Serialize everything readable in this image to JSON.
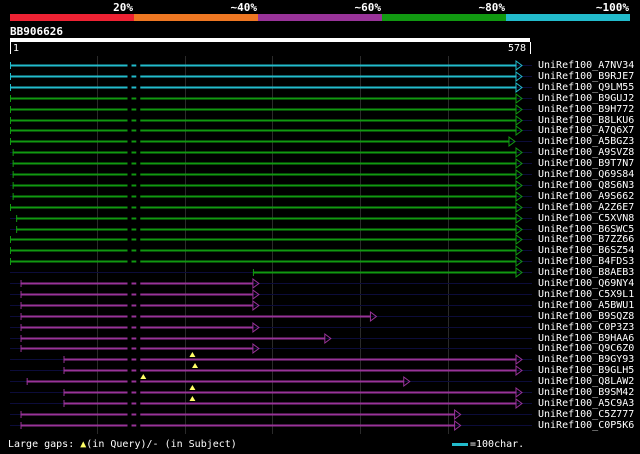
{
  "header": {
    "percent_labels": [
      "20%",
      "~40%",
      "~60%",
      "~80%",
      "~100%"
    ],
    "bar_colors": [
      "#ee2233",
      "#ee7722",
      "#993399",
      "#119911",
      "#22bbcc"
    ]
  },
  "query": {
    "name": "BB906626",
    "start": "1",
    "end": "578",
    "length": 578
  },
  "hits": [
    {
      "name": "UniRef100_A7NV34",
      "color": "#22bbcc",
      "start": 1,
      "end": 578,
      "gaps_query": []
    },
    {
      "name": "UniRef100_B9RJE7",
      "color": "#22bbcc",
      "start": 1,
      "end": 578,
      "gaps_query": []
    },
    {
      "name": "UniRef100_Q9LM55",
      "color": "#22bbcc",
      "start": 1,
      "end": 578,
      "gaps_query": []
    },
    {
      "name": "UniRef100_B9GUJ2",
      "color": "#119911",
      "start": 1,
      "end": 578,
      "gaps_query": []
    },
    {
      "name": "UniRef100_B9H772",
      "color": "#119911",
      "start": 1,
      "end": 578,
      "gaps_query": []
    },
    {
      "name": "UniRef100_B8LKU6",
      "color": "#119911",
      "start": 1,
      "end": 578,
      "gaps_query": []
    },
    {
      "name": "UniRef100_A7Q6X7",
      "color": "#119911",
      "start": 1,
      "end": 578,
      "gaps_query": []
    },
    {
      "name": "UniRef100_A5BGZ3",
      "color": "#119911",
      "start": 1,
      "end": 570,
      "gaps_query": []
    },
    {
      "name": "UniRef100_A9SVZ8",
      "color": "#119911",
      "start": 4,
      "end": 578,
      "gaps_query": []
    },
    {
      "name": "UniRef100_B9T7N7",
      "color": "#119911",
      "start": 4,
      "end": 578,
      "gaps_query": []
    },
    {
      "name": "UniRef100_Q69S84",
      "color": "#119911",
      "start": 4,
      "end": 578,
      "gaps_query": []
    },
    {
      "name": "UniRef100_Q8S6N3",
      "color": "#119911",
      "start": 4,
      "end": 578,
      "gaps_query": []
    },
    {
      "name": "UniRef100_A9S662",
      "color": "#119911",
      "start": 4,
      "end": 578,
      "gaps_query": []
    },
    {
      "name": "UniRef100_A2Z6E7",
      "color": "#119911",
      "start": 1,
      "end": 578,
      "gaps_query": []
    },
    {
      "name": "UniRef100_C5XVN8",
      "color": "#119911",
      "start": 8,
      "end": 578,
      "gaps_query": []
    },
    {
      "name": "UniRef100_B6SWC5",
      "color": "#119911",
      "start": 8,
      "end": 578,
      "gaps_query": []
    },
    {
      "name": "UniRef100_B7ZZ66",
      "color": "#119911",
      "start": 1,
      "end": 578,
      "gaps_query": []
    },
    {
      "name": "UniRef100_B6SZ54",
      "color": "#119911",
      "start": 1,
      "end": 578,
      "gaps_query": []
    },
    {
      "name": "UniRef100_B4FDS3",
      "color": "#119911",
      "start": 1,
      "end": 578,
      "gaps_query": []
    },
    {
      "name": "UniRef100_B8AEB3",
      "color": "#119911",
      "start": 278,
      "end": 578,
      "gaps_query": []
    },
    {
      "name": "UniRef100_Q69NY4",
      "color": "#993399",
      "start": 13,
      "end": 278,
      "gaps_query": []
    },
    {
      "name": "UniRef100_C5X9L1",
      "color": "#993399",
      "start": 13,
      "end": 278,
      "gaps_query": []
    },
    {
      "name": "UniRef100_A5BWU1",
      "color": "#993399",
      "start": 13,
      "end": 278,
      "gaps_query": []
    },
    {
      "name": "UniRef100_B9SQZ8",
      "color": "#993399",
      "start": 13,
      "end": 412,
      "gaps_query": []
    },
    {
      "name": "UniRef100_C0P3Z3",
      "color": "#993399",
      "start": 13,
      "end": 278,
      "gaps_query": []
    },
    {
      "name": "UniRef100_B9HAA6",
      "color": "#993399",
      "start": 13,
      "end": 360,
      "gaps_query": []
    },
    {
      "name": "UniRef100_Q9C6Z0",
      "color": "#993399",
      "start": 13,
      "end": 278,
      "gaps_query": []
    },
    {
      "name": "UniRef100_B9GY93",
      "color": "#993399",
      "start": 62,
      "end": 578,
      "gaps_query": [
        209
      ]
    },
    {
      "name": "UniRef100_B9GLH5",
      "color": "#993399",
      "start": 62,
      "end": 578,
      "gaps_query": [
        212
      ]
    },
    {
      "name": "UniRef100_Q8LAW2",
      "color": "#993399",
      "start": 20,
      "end": 450,
      "gaps_query": [
        153
      ]
    },
    {
      "name": "UniRef100_B9SM42",
      "color": "#993399",
      "start": 62,
      "end": 578,
      "gaps_query": [
        209
      ]
    },
    {
      "name": "UniRef100_A5C9A3",
      "color": "#993399",
      "start": 62,
      "end": 578,
      "gaps_query": [
        209
      ]
    },
    {
      "name": "UniRef100_C5Z777",
      "color": "#993399",
      "start": 13,
      "end": 508,
      "gaps_query": []
    },
    {
      "name": "UniRef100_C0P5K6",
      "color": "#993399",
      "start": 13,
      "end": 508,
      "gaps_query": []
    }
  ],
  "legend": {
    "prefix": "Large gaps: ",
    "query_symbol": "▲",
    "query_text": "(in Query)/",
    "subject_symbol": "-",
    "subject_text": " (in Subject)",
    "scale_label": "=100char."
  }
}
